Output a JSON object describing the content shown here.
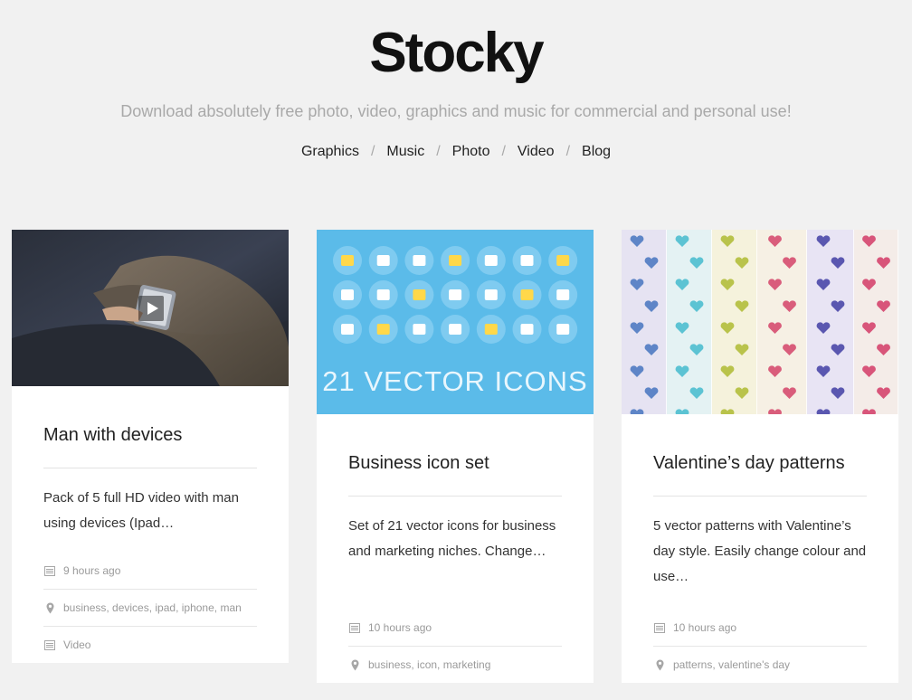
{
  "site": {
    "logo": "Stocky",
    "tagline": "Download absolutely free photo, video, graphics and music for commercial and personal use!",
    "nav": [
      "Graphics",
      "Music",
      "Photo",
      "Video",
      "Blog"
    ],
    "nav_separator": "/"
  },
  "cards": [
    {
      "title": "Man with devices",
      "description": "Pack of 5 full HD video with man using devices (Ipad…",
      "time": "9 hours ago",
      "tags": "business, devices, ipad, iphone, man",
      "category": "Video",
      "thumbnail": "video-thumbnail"
    },
    {
      "title": "Business icon set",
      "description": "Set of 21 vector icons for business and marketing niches. Change…",
      "time": "10 hours ago",
      "tags": "business, icon, marketing",
      "thumbnail_text": "21 VECTOR ICONS"
    },
    {
      "title": "Valentine’s day patterns",
      "description": "5 vector patterns with Valentine’s day style. Easily change colour and use…",
      "time": "10 hours ago",
      "tags": "patterns, valentine's day"
    }
  ],
  "colors": {
    "background": "#f1f1f1",
    "icons_bg": "#5bbbe9",
    "icon_circle": "#7fcbf0"
  }
}
